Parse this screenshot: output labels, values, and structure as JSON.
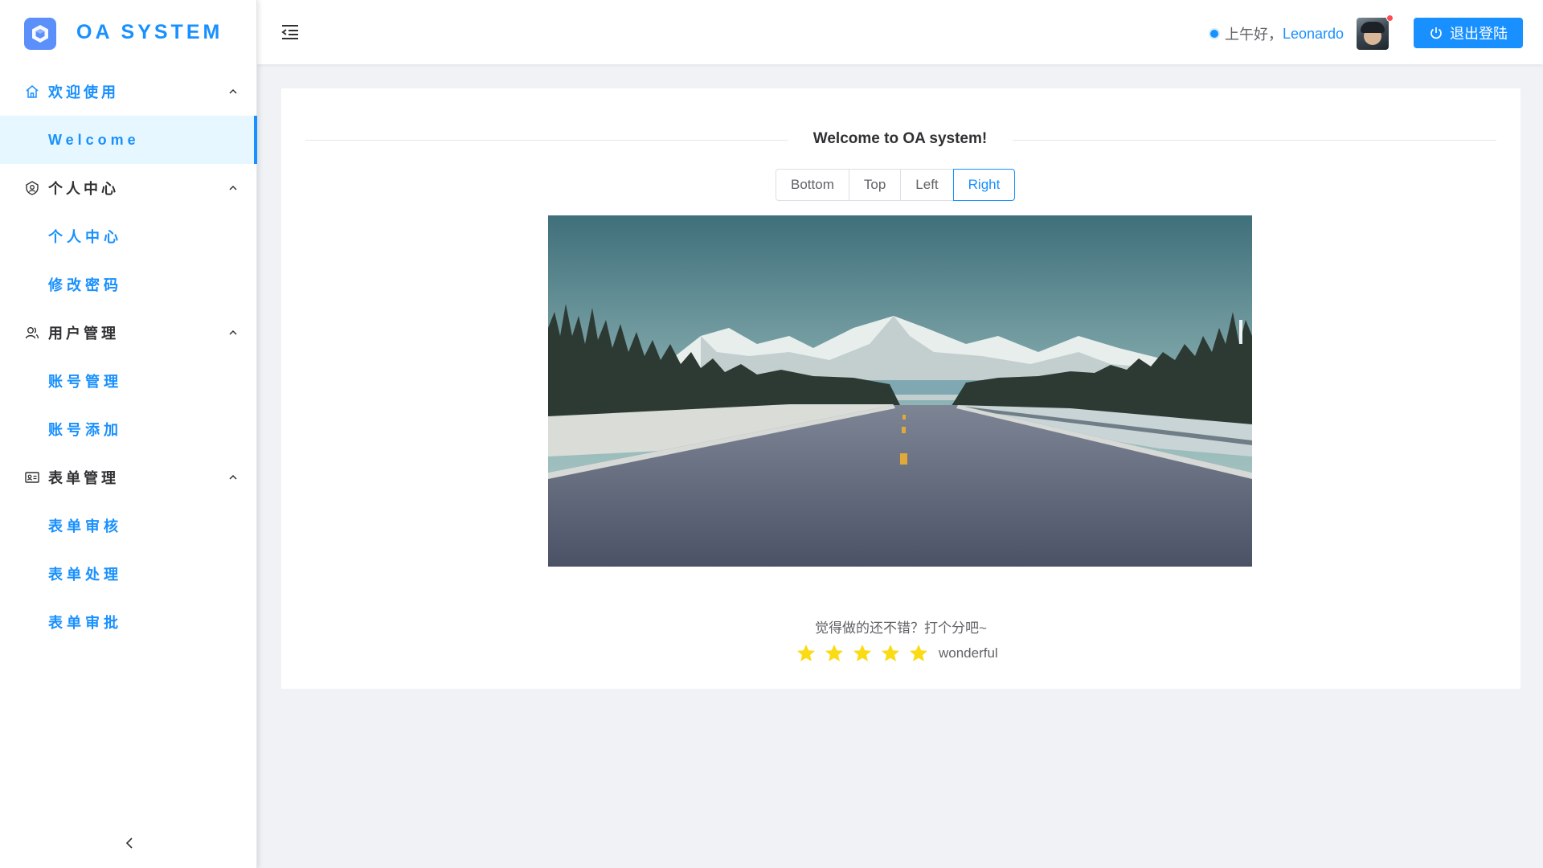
{
  "app": {
    "title": "OA SYSTEM"
  },
  "sidebar": {
    "groups": [
      {
        "label": "欢迎使用",
        "icon": "home-icon",
        "items": [
          {
            "label": "Welcome"
          }
        ]
      },
      {
        "label": "个人中心",
        "icon": "user-badge-icon",
        "items": [
          {
            "label": "个人中心"
          },
          {
            "label": "修改密码"
          }
        ]
      },
      {
        "label": "用户管理",
        "icon": "users-icon",
        "items": [
          {
            "label": "账号管理"
          },
          {
            "label": "账号添加"
          }
        ]
      },
      {
        "label": "表单管理",
        "icon": "id-card-icon",
        "items": [
          {
            "label": "表单审核"
          },
          {
            "label": "表单处理"
          },
          {
            "label": "表单审批"
          }
        ]
      }
    ],
    "selected": "Welcome",
    "collapse_icon": "chevron-left-icon"
  },
  "header": {
    "greeting": "上午好，",
    "username": "Leonardo",
    "logout_label": "退出登陆",
    "logout_icon": "power-icon",
    "menu_toggle_icon": "menu-fold-icon"
  },
  "main": {
    "title": "Welcome to OA system!",
    "placement_options": [
      "Bottom",
      "Top",
      "Left",
      "Right"
    ],
    "selected_placement": "Right",
    "rating_question": "觉得做的还不错？打个分吧~",
    "rating_value": 5,
    "rating_max": 5,
    "rating_text": "wonderful"
  },
  "colors": {
    "primary": "#1890ff",
    "star": "#fadb14",
    "text": "#303133",
    "background": "#f0f2f5"
  }
}
